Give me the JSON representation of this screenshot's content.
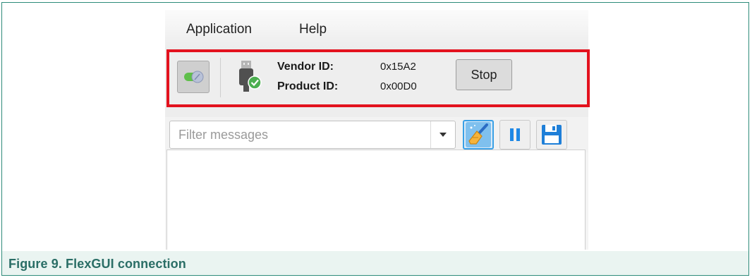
{
  "caption": "Figure 9.  FlexGUI connection",
  "menu": [
    {
      "label": "Application"
    },
    {
      "label": "Help"
    }
  ],
  "connection": {
    "vendor_label": "Vendor ID:",
    "vendor_value": "0x15A2",
    "product_label": "Product ID:",
    "product_value": "0x00D0",
    "stop_label": "Stop"
  },
  "filter": {
    "placeholder": "Filter messages",
    "value": ""
  },
  "icons": {
    "toggle": "connect-toggle-icon",
    "device": "usb-device-connected-icon",
    "clear": "broom-icon",
    "pause": "pause-icon",
    "save": "floppy-disk-icon"
  },
  "colors": {
    "highlight": "#e3121e",
    "caption": "#2a6e66",
    "accent_blue": "#1e88e5",
    "connected_green": "#4caf50"
  }
}
